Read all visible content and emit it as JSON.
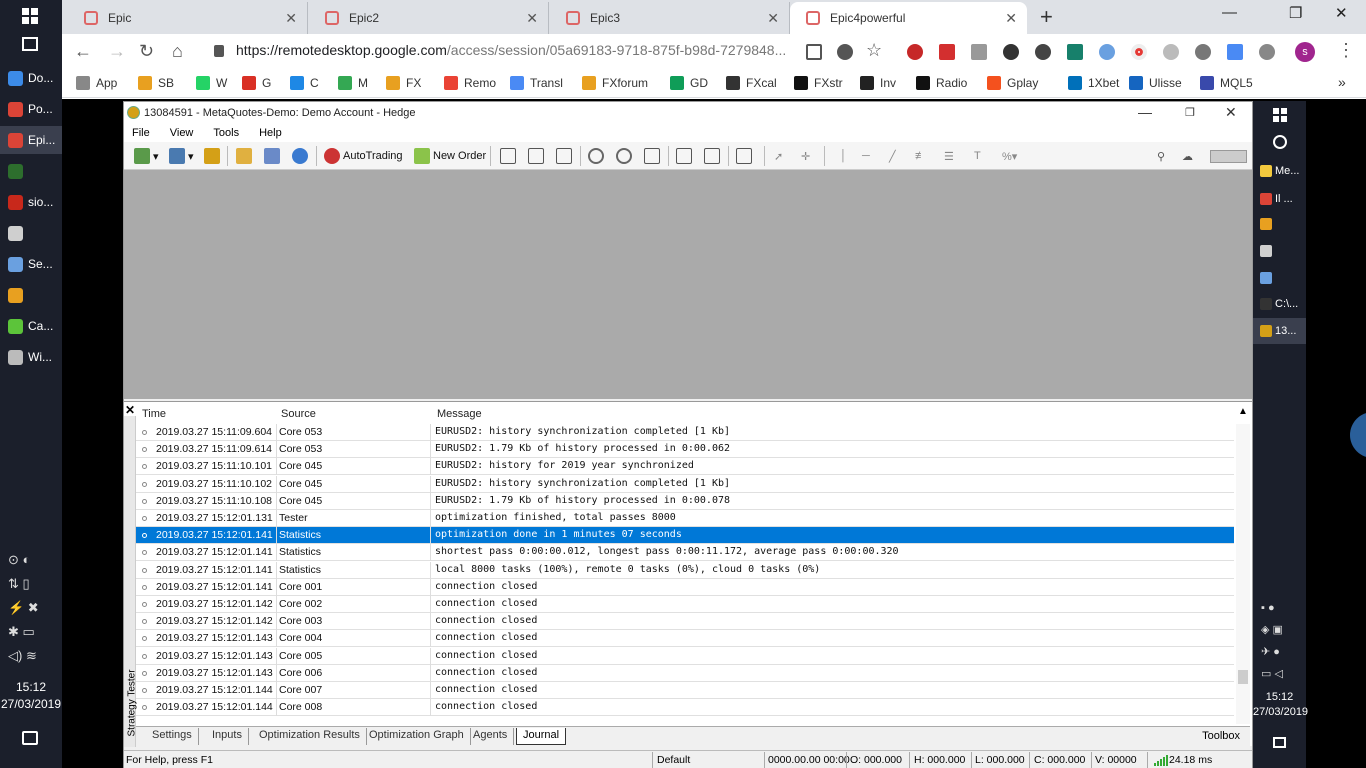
{
  "left_taskbar": {
    "items": [
      {
        "label": "Do...",
        "color": "#3c8be8"
      },
      {
        "label": "Po...",
        "color": "#db4437"
      },
      {
        "label": "Epi...",
        "color": "#db4437"
      },
      {
        "label": "",
        "color": "#2d6e2d"
      },
      {
        "label": "sio...",
        "color": "#c8281b"
      },
      {
        "label": "",
        "color": "#cfcfcf"
      },
      {
        "label": "Se...",
        "color": "#6aa0e0"
      },
      {
        "label": "",
        "color": "#e8a020"
      },
      {
        "label": "Ca...",
        "color": "#5cc43a"
      },
      {
        "label": "Wi...",
        "color": "#bbbbbb"
      }
    ],
    "time": "15:12",
    "date": "27/03/2019"
  },
  "browser": {
    "tabs": [
      {
        "title": "Epic"
      },
      {
        "title": "Epic2"
      },
      {
        "title": "Epic3"
      },
      {
        "title": "Epic4powerful"
      }
    ],
    "new_tab": "+",
    "url_host": "https://remotedesktop.google.com",
    "url_path": "/access/session/05a69183-9718-875f-b98d-7279848...",
    "bookmarks": [
      "App",
      "SB",
      "W",
      "G",
      "C",
      "M",
      "FX",
      "Remo",
      "Transl",
      "FXforum",
      "GD",
      "FXcal",
      "FXstr",
      "Inv",
      "Radio",
      "Gplay",
      "1Xbet",
      "Ulisse",
      "MQL5"
    ],
    "bookmarks_more": "»",
    "profile_initial": "s"
  },
  "mt5": {
    "title": "13084591 - MetaQuotes-Demo: Demo Account - Hedge",
    "menu": [
      "File",
      "View",
      "Tools",
      "Help"
    ],
    "toolbar": {
      "autotrading": "AutoTrading",
      "new_order": "New Order"
    },
    "journal": {
      "columns": [
        "Time",
        "Source",
        "Message"
      ],
      "rows": [
        {
          "time": "2019.03.27 15:11:09.604",
          "source": "Core 053",
          "message": "EURUSD2: history synchronization completed [1 Kb]"
        },
        {
          "time": "2019.03.27 15:11:09.614",
          "source": "Core 053",
          "message": "EURUSD2: 1.79 Kb of history processed in 0:00.062"
        },
        {
          "time": "2019.03.27 15:11:10.101",
          "source": "Core 045",
          "message": "EURUSD2: history for 2019 year synchronized"
        },
        {
          "time": "2019.03.27 15:11:10.102",
          "source": "Core 045",
          "message": "EURUSD2: history synchronization completed [1 Kb]"
        },
        {
          "time": "2019.03.27 15:11:10.108",
          "source": "Core 045",
          "message": "EURUSD2: 1.79 Kb of history processed in 0:00.078"
        },
        {
          "time": "2019.03.27 15:12:01.131",
          "source": "Tester",
          "message": "optimization finished, total passes 8000"
        },
        {
          "time": "2019.03.27 15:12:01.141",
          "source": "Statistics",
          "message": "optimization done in 1 minutes 07 seconds"
        },
        {
          "time": "2019.03.27 15:12:01.141",
          "source": "Statistics",
          "message": "shortest pass 0:00:00.012, longest pass 0:00:11.172, average pass 0:00:00.320"
        },
        {
          "time": "2019.03.27 15:12:01.141",
          "source": "Statistics",
          "message": "local 8000 tasks (100%), remote 0 tasks (0%), cloud 0 tasks (0%)"
        },
        {
          "time": "2019.03.27 15:12:01.141",
          "source": "Core 001",
          "message": "connection closed"
        },
        {
          "time": "2019.03.27 15:12:01.142",
          "source": "Core 002",
          "message": "connection closed"
        },
        {
          "time": "2019.03.27 15:12:01.142",
          "source": "Core 003",
          "message": "connection closed"
        },
        {
          "time": "2019.03.27 15:12:01.143",
          "source": "Core 004",
          "message": "connection closed"
        },
        {
          "time": "2019.03.27 15:12:01.143",
          "source": "Core 005",
          "message": "connection closed"
        },
        {
          "time": "2019.03.27 15:12:01.143",
          "source": "Core 006",
          "message": "connection closed"
        },
        {
          "time": "2019.03.27 15:12:01.144",
          "source": "Core 007",
          "message": "connection closed"
        },
        {
          "time": "2019.03.27 15:12:01.144",
          "source": "Core 008",
          "message": "connection closed"
        }
      ],
      "selected_index": 6
    },
    "side_label": "Strategy Tester",
    "tabs": [
      "Settings",
      "Inputs",
      "Optimization Results",
      "Optimization Graph",
      "Agents",
      "Journal"
    ],
    "active_tab": "Journal",
    "toolbox": "Toolbox",
    "status": {
      "help": "For Help, press F1",
      "profile": "Default",
      "datetime": "0000.00.00 00:00",
      "open": "O: 000.000",
      "high": "H: 000.000",
      "low": "L: 000.000",
      "close": "C: 000.000",
      "volume": "V: 00000",
      "ping": "24.18 ms"
    }
  },
  "right_taskbar": {
    "items": [
      {
        "label": "Me...",
        "color": "#f3c93e"
      },
      {
        "label": "Il ...",
        "color": "#db4437"
      },
      {
        "label": "",
        "color": "#e8a020"
      },
      {
        "label": "",
        "color": "#cfcfcf"
      },
      {
        "label": "",
        "color": "#6aa0e0"
      },
      {
        "label": "C:\\...",
        "color": "#333333"
      },
      {
        "label": "13...",
        "color": "#d4a017"
      }
    ],
    "time": "15:12",
    "date": "27/03/2019"
  },
  "colors": {
    "selection": "#0078d7",
    "taskbar": "#1b1f2b",
    "chart_bg": "#aaaaaa"
  }
}
